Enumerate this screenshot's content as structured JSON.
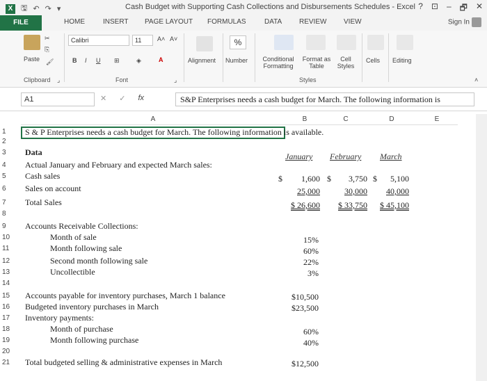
{
  "window": {
    "title": "Cash Budget with Supporting Cash Collections and Disbursements Schedules - Excel",
    "logo": "X",
    "controls": [
      "?",
      "⊡",
      "–",
      "🗗",
      "✕"
    ]
  },
  "tabs": [
    "FILE",
    "HOME",
    "INSERT",
    "PAGE LAYOUT",
    "FORMULAS",
    "DATA",
    "REVIEW",
    "VIEW"
  ],
  "signin": "Sign In",
  "ribbon": {
    "paste": "Paste",
    "clipboard": "Clipboard",
    "font_name": "Calibri",
    "font_size": "11",
    "font_group": "Font",
    "bold": "B",
    "italic": "I",
    "underline": "U",
    "grow": "A˄",
    "shrink": "A˅",
    "alignment": "Alignment",
    "number": "Number",
    "percent": "%",
    "conditional_1": "Conditional",
    "conditional_2": "Formatting",
    "format_as_1": "Format as",
    "format_as_2": "Table",
    "cell_styles_1": "Cell",
    "cell_styles_2": "Styles",
    "styles_group": "Styles",
    "cells": "Cells",
    "editing": "Editing"
  },
  "formula_bar": {
    "name_box": "A1",
    "fx": "fx",
    "content": "S&P Enterprises needs a cash budget for March. The following information is"
  },
  "columns": [
    "A",
    "B",
    "C",
    "D",
    "E"
  ],
  "sheet": {
    "r1": "S & P Enterprises needs a cash budget for March. The following information is available.",
    "r3": "Data",
    "r4": "Actual January and February and expected March sales:",
    "r5": "Cash sales",
    "r6": "Sales on account",
    "r7": "Total Sales",
    "r9": "Accounts Receivable Collections:",
    "r10": "Month of sale",
    "r11": "Month following sale",
    "r12": "Second month following sale",
    "r13": "Uncollectible",
    "r15": "Accounts payable for inventory purchases, March 1 balance",
    "r16": "Budgeted inventory purchases in March",
    "r17": "Inventory payments:",
    "r18": "Month of purchase",
    "r19": "Month following purchase",
    "r21": "Total budgeted selling & administrative expenses in March",
    "months": [
      "January",
      "February",
      "March"
    ],
    "cash_sales": [
      "$",
      "1,600",
      "$",
      "3,750",
      "$",
      "5,100"
    ],
    "sales_on_account": [
      "25,000",
      "30,000",
      "40,000"
    ],
    "total_sales": [
      "$ 26,600",
      "$ 33,750",
      "$ 45,100"
    ],
    "ar_pcts": [
      "15%",
      "60%",
      "22%",
      "3%"
    ],
    "ap_balance": "$10,500",
    "purchases": "$23,500",
    "inv_pcts": [
      "60%",
      "40%"
    ],
    "sga": "$12,500"
  },
  "row_numbers": [
    "1",
    "2",
    "3",
    "4",
    "5",
    "6",
    "7",
    "8",
    "9",
    "10",
    "11",
    "12",
    "13",
    "14",
    "15",
    "16",
    "17",
    "18",
    "19",
    "20",
    "21"
  ]
}
